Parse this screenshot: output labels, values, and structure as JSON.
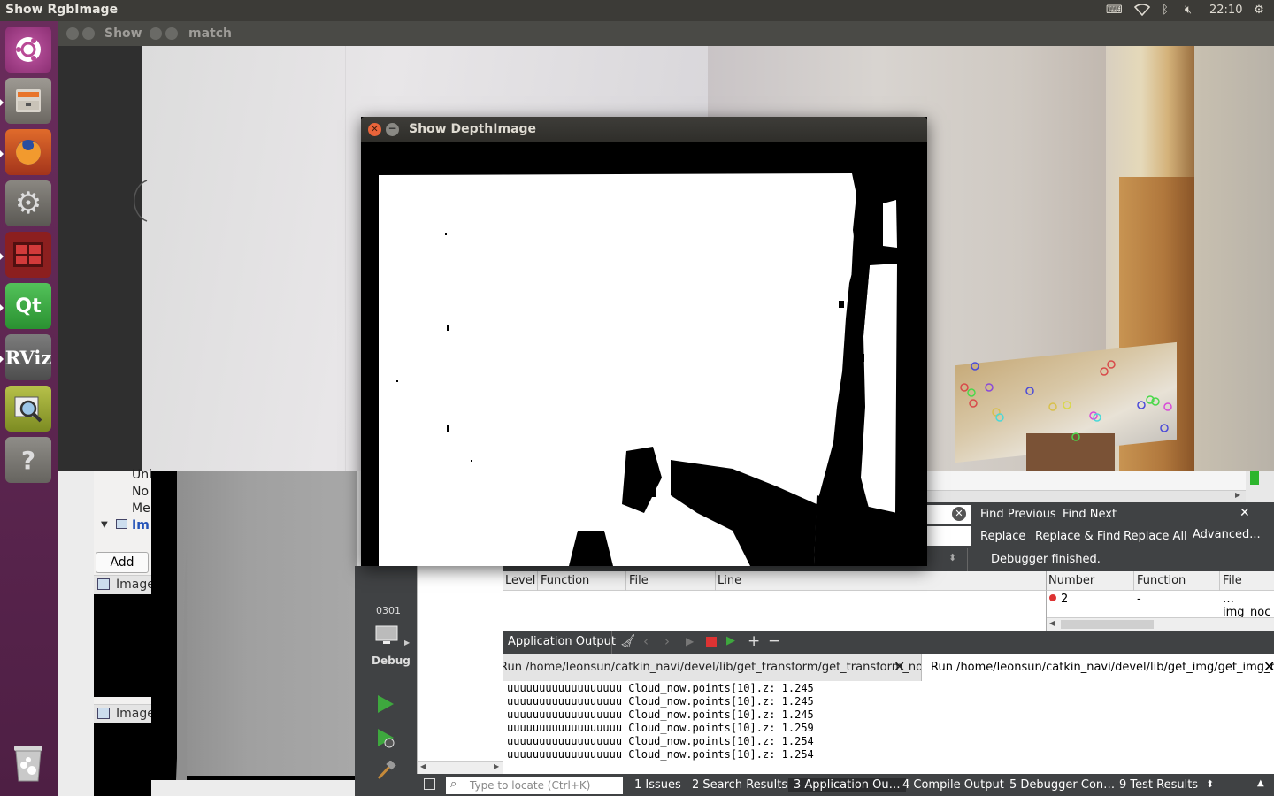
{
  "top_panel": {
    "title": "Show RgbImage",
    "clock": "22:10"
  },
  "background_window": {
    "title_1": "Show",
    "title_2": "match"
  },
  "depth_window": {
    "title": "Show DepthImage"
  },
  "qt": {
    "tree_items": [
      "Uni",
      "No",
      "Me",
      "Im"
    ],
    "add_button": "Add",
    "image_label_1": "Image",
    "image_label_2": "Image",
    "mode_badge": "0301",
    "debug_label": "Debug",
    "find": {
      "find_previous": "Find Previous",
      "find_next": "Find Next",
      "replace": "Replace",
      "replace_find": "Replace & Find",
      "replace_all": "Replace All",
      "advanced": "Advanced..."
    },
    "debug_status": "Debugger finished.",
    "stack_columns": [
      "Level",
      "Function",
      "File",
      "Line"
    ],
    "breakpoint_columns": [
      "Number",
      "Function",
      "File"
    ],
    "breakpoint_row": {
      "number": "2",
      "function": "-",
      "file": "…img_noc"
    },
    "app_output_label": "Application Output",
    "run_tabs": [
      "Run /home/leonsun/catkin_navi/devel/lib/get_transform/get_transform_node",
      "Run /home/leonsun/catkin_navi/devel/lib/get_img/get_img_node"
    ],
    "output_lines": [
      "uuuuuuuuuuuuuuuuuu Cloud_now.points[10].z: 1.245",
      "uuuuuuuuuuuuuuuuuu Cloud_now.points[10].z: 1.245",
      "uuuuuuuuuuuuuuuuuu Cloud_now.points[10].z: 1.245",
      "uuuuuuuuuuuuuuuuuu Cloud_now.points[10].z: 1.259",
      "uuuuuuuuuuuuuuuuuu Cloud_now.points[10].z: 1.254",
      "uuuuuuuuuuuuuuuuuu Cloud_now.points[10].z: 1.254"
    ],
    "locator_placeholder": "Type to locate (Ctrl+K)",
    "bottom_tabs": [
      "1  Issues",
      "2  Search Results",
      "3  Application Ou…",
      "4  Compile Output",
      "5  Debugger Con…",
      "9  Test Results"
    ]
  },
  "launcher": {
    "items": [
      "ubuntu-dash",
      "files",
      "firefox",
      "system-settings",
      "terminal-workspaces",
      "qt-creator",
      "rviz",
      "image-viewer",
      "help",
      "trash"
    ],
    "qt_label": "Qt",
    "rviz_label": "RViz",
    "help_label": "?"
  },
  "colors": {
    "launcher": "#5e2750",
    "panel": "#3c3b37",
    "qt_dark": "#404244",
    "close_orange": "#e9643a"
  }
}
